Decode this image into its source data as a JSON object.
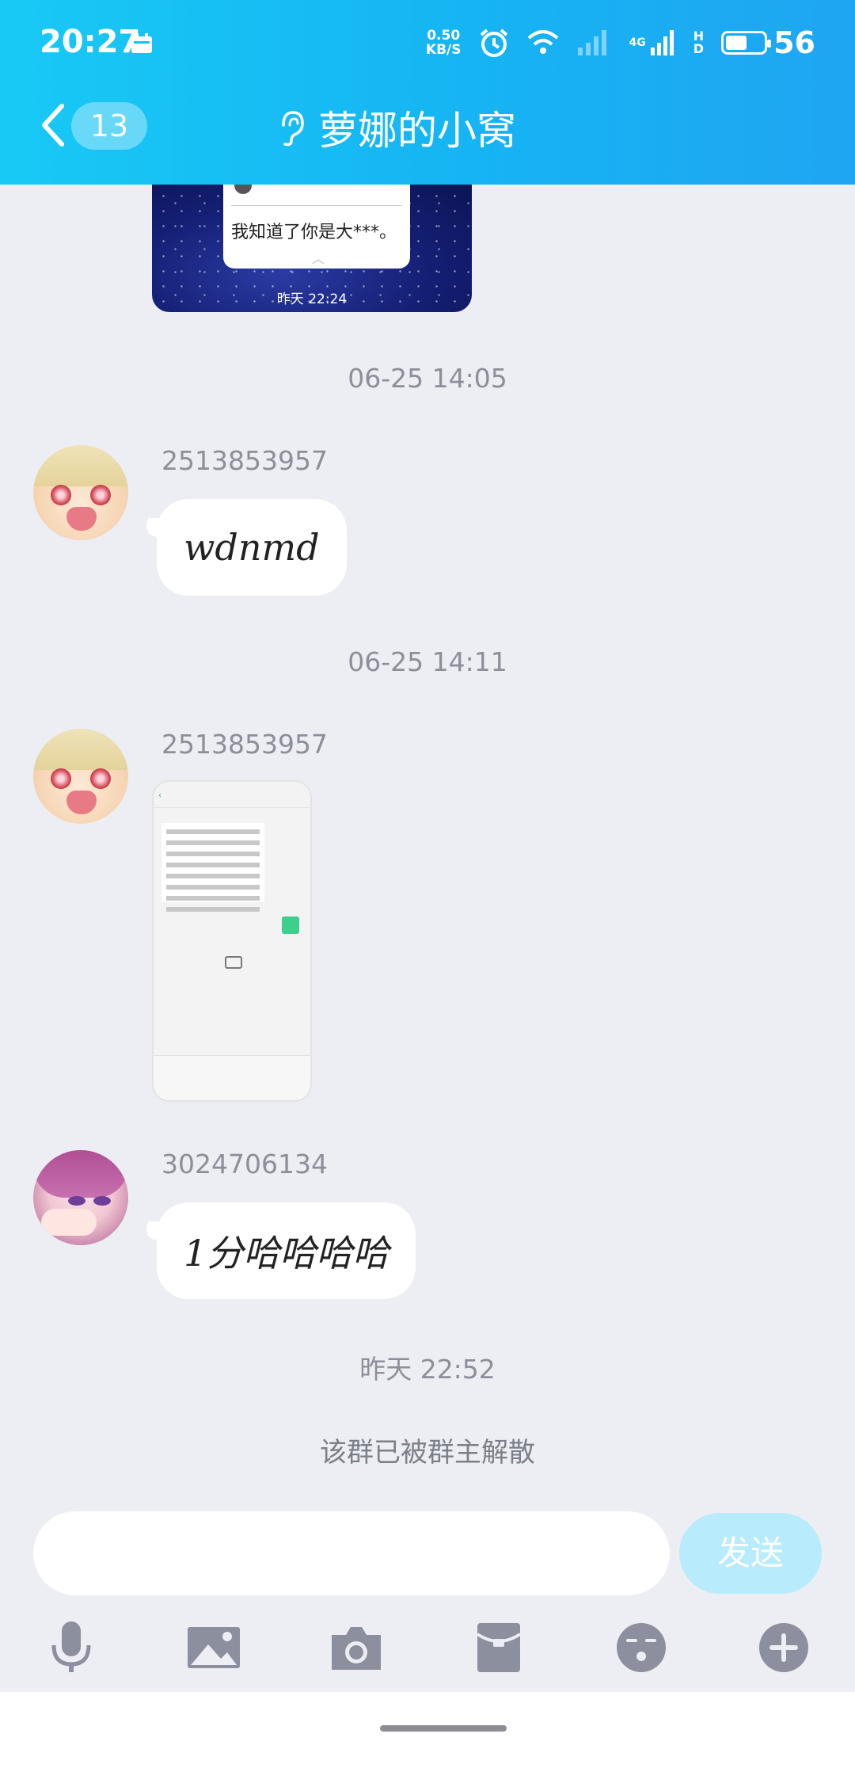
{
  "status_bar": {
    "time": "20:27",
    "net_speed_value": "0.50",
    "net_speed_unit": "KB/S",
    "signal_label": "4G",
    "hd_label": "H\nD",
    "battery_level": "56",
    "battery_fraction": 0.56
  },
  "header": {
    "back_badge": "13",
    "title": "萝娜的小窝",
    "accent": "#16b4f3"
  },
  "messages": {
    "image_card": {
      "popup_text": "我知道了你是大***。",
      "time": "昨天 22:24"
    },
    "timestamp_1": "06-25 14:05",
    "msg1": {
      "sender": "2513853957",
      "text": "wdnmd"
    },
    "timestamp_2": "06-25 14:11",
    "msg2": {
      "sender": "2513853957",
      "image": "screenshot"
    },
    "msg3": {
      "sender": "3024706134",
      "text": "1分哈哈哈哈"
    },
    "timestamp_3": "昨天 22:52",
    "system_notice": "该群已被群主解散"
  },
  "composer": {
    "input_value": "",
    "send_label": "发送"
  },
  "toolbar": {
    "icons": [
      "microphone-icon",
      "picture-icon",
      "camera-icon",
      "red-packet-icon",
      "emoji-icon",
      "plus-icon"
    ]
  }
}
